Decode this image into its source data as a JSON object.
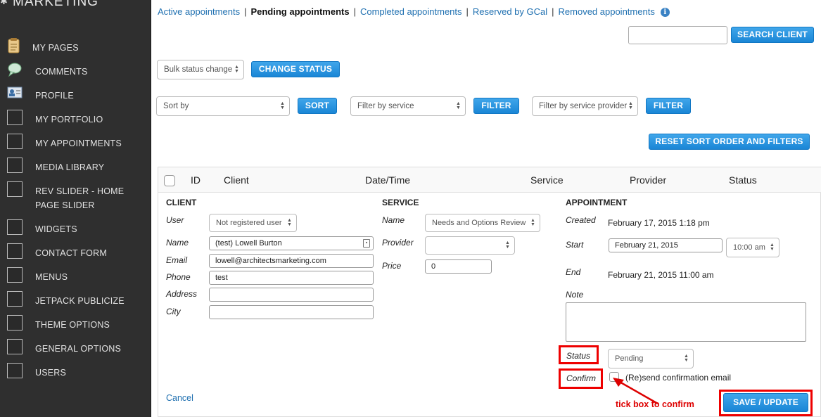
{
  "sidebar": {
    "brand": "MARKETING",
    "items": [
      {
        "label": "MY PAGES",
        "icon": "notepad-icon"
      },
      {
        "label": "COMMENTS",
        "icon": "speech-bubble-icon"
      },
      {
        "label": "PROFILE",
        "icon": "profile-card-icon"
      },
      {
        "label": "MY PORTFOLIO",
        "icon": "placeholder-icon"
      },
      {
        "label": "MY APPOINTMENTS",
        "icon": "placeholder-icon"
      },
      {
        "label": "MEDIA LIBRARY",
        "icon": "placeholder-icon"
      },
      {
        "label": "REV SLIDER - HOME",
        "label2": "PAGE SLIDER",
        "icon": "placeholder-icon"
      },
      {
        "label": "WIDGETS",
        "icon": "placeholder-icon"
      },
      {
        "label": "CONTACT FORM",
        "icon": "placeholder-icon"
      },
      {
        "label": "MENUS",
        "icon": "placeholder-icon"
      },
      {
        "label": "JETPACK PUBLICIZE",
        "icon": "placeholder-icon"
      },
      {
        "label": "THEME OPTIONS",
        "icon": "placeholder-icon"
      },
      {
        "label": "GENERAL OPTIONS",
        "icon": "placeholder-icon"
      },
      {
        "label": "USERS",
        "icon": "placeholder-icon"
      }
    ]
  },
  "tabs": {
    "active": "Active appointments",
    "pending": "Pending appointments",
    "completed": "Completed appointments",
    "gcal": "Reserved by GCal",
    "removed": "Removed appointments",
    "separator": "|",
    "info": "i"
  },
  "search": {
    "value": "",
    "button": "SEARCH CLIENT"
  },
  "bulk": {
    "select": "Bulk status change",
    "button": "CHANGE STATUS"
  },
  "sort": {
    "select": "Sort by",
    "button": "SORT"
  },
  "filter_service": {
    "select": "Filter by service",
    "button": "FILTER"
  },
  "filter_provider": {
    "select": "Filter by service provider",
    "button": "FILTER"
  },
  "reset": {
    "button": "RESET SORT ORDER AND FILTERS"
  },
  "table": {
    "columns": [
      "ID",
      "Client",
      "Date/Time",
      "Service",
      "Provider",
      "Status"
    ]
  },
  "client": {
    "title": "CLIENT",
    "user_label": "User",
    "user_value": "Not registered user",
    "name_label": "Name",
    "name_value": "(test) Lowell Burton",
    "email_label": "Email",
    "email_value": "lowell@architectsmarketing.com",
    "phone_label": "Phone",
    "phone_value": "test",
    "address_label": "Address",
    "address_value": "",
    "city_label": "City",
    "city_value": ""
  },
  "service": {
    "title": "SERVICE",
    "name_label": "Name",
    "name_value": "Needs and Options Review",
    "provider_label": "Provider",
    "provider_value": "",
    "price_label": "Price",
    "price_value": "0"
  },
  "appointment": {
    "title": "APPOINTMENT",
    "created_label": "Created",
    "created_value": "February 17, 2015 1:18 pm",
    "start_label": "Start",
    "start_date": "February 21, 2015",
    "start_time": "10:00 am",
    "end_label": "End",
    "end_value": "February 21, 2015 11:00 am",
    "note_label": "Note",
    "note_value": "",
    "status_label": "Status",
    "status_value": "Pending",
    "confirm_label": "Confirm",
    "confirm_text": "(Re)send confirmation email"
  },
  "actions": {
    "cancel": "Cancel",
    "save": "SAVE / UPDATE"
  },
  "annotation": {
    "text": "tick box to confirm",
    "color": "#dd0000"
  }
}
